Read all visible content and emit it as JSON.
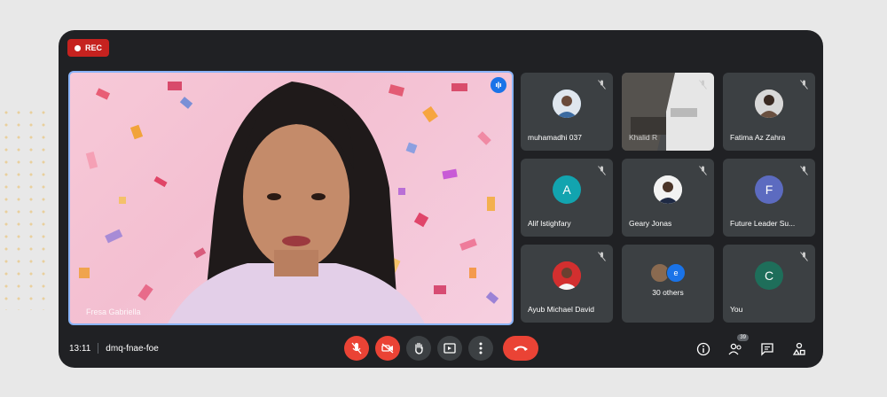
{
  "recording": {
    "label": "REC"
  },
  "main_speaker": {
    "name": "Fresa Gabriella"
  },
  "participants": [
    {
      "name": "muhamadhi 037",
      "type": "photo",
      "avatar_color": "#5b8bb4"
    },
    {
      "name": "Khalid R",
      "type": "video"
    },
    {
      "name": "Fatima Az Zahra",
      "type": "photo",
      "avatar_color": "#c9b3a6"
    },
    {
      "name": "Alif Istighfary",
      "type": "letter",
      "initial": "A",
      "avatar_color": "#12a4af"
    },
    {
      "name": "Geary Jonas",
      "type": "photo",
      "avatar_color": "#ffffff"
    },
    {
      "name": "Future Leader Su...",
      "type": "letter",
      "initial": "F",
      "avatar_color": "#5c6bc0"
    },
    {
      "name": "Ayub Michael David",
      "type": "photo",
      "avatar_color": "#d32f2f"
    },
    {
      "name": "30 others",
      "type": "group",
      "group_initial": "e",
      "avatar_color": "#1a73e8"
    },
    {
      "name": "You",
      "type": "letter",
      "initial": "C",
      "avatar_color": "#1e6e5a"
    }
  ],
  "bottom_bar": {
    "time": "13:11",
    "meeting_code": "dmq-fnae-foe",
    "people_count": "39"
  },
  "colors": {
    "accent": "#8ab4f8",
    "danger": "#ea4335",
    "bar_bg": "#202124",
    "tile_bg": "#3c4043"
  }
}
